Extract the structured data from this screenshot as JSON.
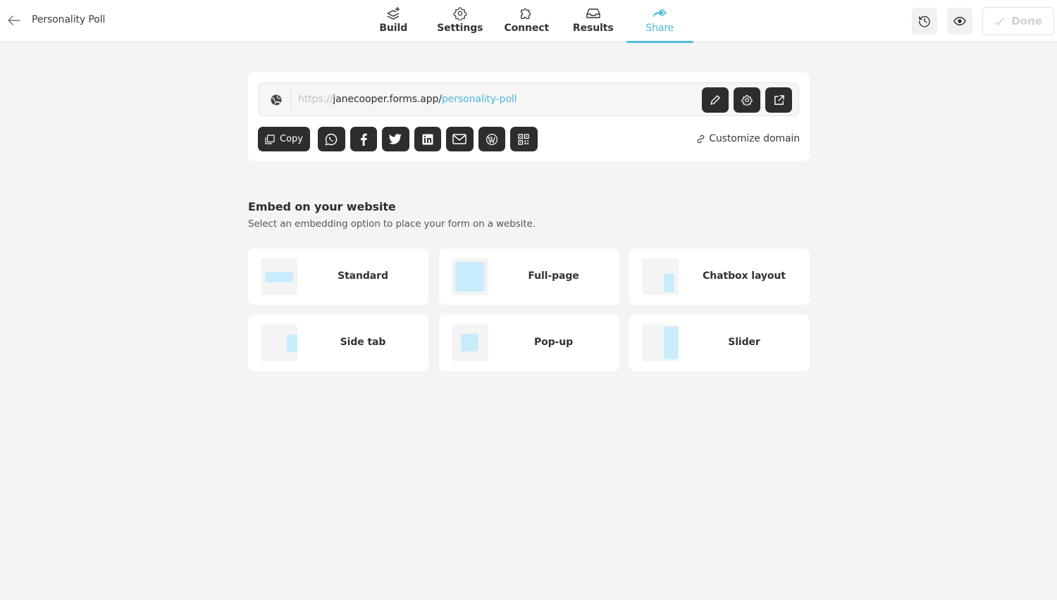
{
  "header": {
    "title": "Personality Poll",
    "tabs": [
      {
        "label": "Build",
        "icon": "layers-plus-icon",
        "active": false
      },
      {
        "label": "Settings",
        "icon": "gear-icon",
        "active": false
      },
      {
        "label": "Connect",
        "icon": "puzzle-icon",
        "active": false
      },
      {
        "label": "Results",
        "icon": "inbox-icon",
        "active": false
      },
      {
        "label": "Share",
        "icon": "share-forward-icon",
        "active": true
      }
    ],
    "done_label": "Done"
  },
  "share": {
    "url_protocol": "https://",
    "url_domain": "janecooper.forms.app/",
    "url_slug": "personality-poll",
    "copy_label": "Copy",
    "social": [
      "whatsapp-icon",
      "facebook-icon",
      "twitter-icon",
      "linkedin-icon",
      "email-icon",
      "wordpress-icon",
      "qr-code-icon"
    ],
    "customize_domain_label": "Customize domain"
  },
  "embed": {
    "title": "Embed on your website",
    "subtitle": "Select an embedding option to place your form on a website.",
    "options": [
      {
        "label": "Standard"
      },
      {
        "label": "Full-page"
      },
      {
        "label": "Chatbox layout"
      },
      {
        "label": "Side tab"
      },
      {
        "label": "Pop-up"
      },
      {
        "label": "Slider"
      }
    ]
  },
  "colors": {
    "accent": "#4fb8dd",
    "dark_button": "#2d2d2d",
    "thumb_fill": "#c9ecfb",
    "background": "#f4f4f4"
  }
}
